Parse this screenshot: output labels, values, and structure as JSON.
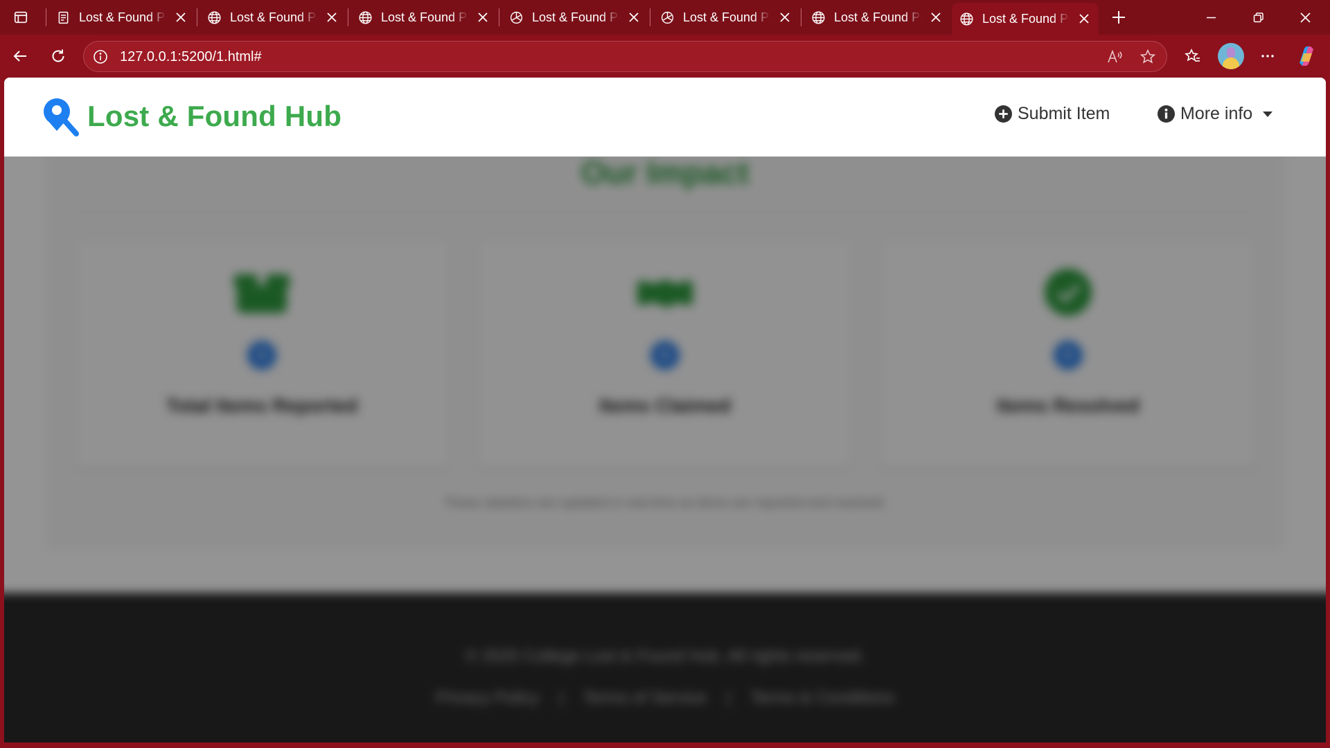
{
  "browser": {
    "tabs": [
      {
        "title": "Lost & Found Portal",
        "favicon": "document-icon",
        "active": false
      },
      {
        "title": "Lost & Found Portal",
        "favicon": "globe-icon",
        "active": false
      },
      {
        "title": "Lost & Found Portal",
        "favicon": "globe-icon",
        "active": false
      },
      {
        "title": "Lost & Found Portal",
        "favicon": "openai-icon",
        "active": false
      },
      {
        "title": "Lost & Found Portal",
        "favicon": "openai-icon",
        "active": false
      },
      {
        "title": "Lost & Found Portal",
        "favicon": "globe-icon",
        "active": false
      },
      {
        "title": "Lost & Found Portal",
        "favicon": "globe-icon",
        "active": true
      }
    ],
    "address": {
      "url": "127.0.0.1:5200/1.html#"
    },
    "colors": {
      "frame": "#8c111c",
      "tabstrip": "#7a0f18"
    }
  },
  "header": {
    "brand": "Lost & Found Hub",
    "brand_color": "#3daa4d",
    "nav": {
      "submit": "Submit Item",
      "more": "More info"
    }
  },
  "impact": {
    "title": "Our Impact",
    "stats": [
      {
        "icon": "box-icon",
        "value": "0",
        "label": "Total Items Reported"
      },
      {
        "icon": "handshake-icon",
        "value": "0",
        "label": "Items Claimed"
      },
      {
        "icon": "check-circle-icon",
        "value": "0",
        "label": "Items Resolved"
      }
    ],
    "note": "These statistics are updated in real time as items are reported and resolved."
  },
  "footer": {
    "copyright": "© 2025 College Lost & Found Hub. All rights reserved.",
    "links": [
      "Privacy Policy",
      "Terms of Service",
      "Terms & Conditions"
    ],
    "separator": "|"
  }
}
